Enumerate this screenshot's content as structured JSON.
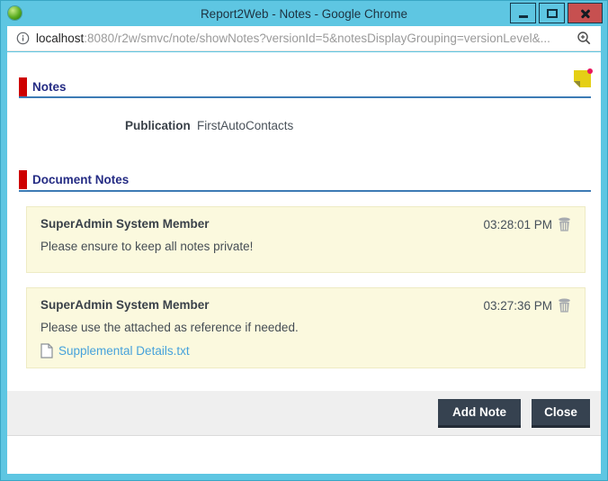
{
  "window": {
    "title": "Report2Web - Notes - Google Chrome"
  },
  "address_bar": {
    "url_host": "localhost",
    "url_path": ":8080/r2w/smvc/note/showNotes?versionId=5&notesDisplayGrouping=versionLevel&..."
  },
  "page": {
    "section_notes": {
      "title": "Notes"
    },
    "publication": {
      "label": "Publication",
      "value": "FirstAutoContacts"
    },
    "section_document_notes": {
      "title": "Document Notes"
    },
    "notes": [
      {
        "author": "SuperAdmin System Member",
        "time": "03:28:01 PM",
        "body": "Please ensure to keep all notes private!"
      },
      {
        "author": "SuperAdmin System Member",
        "time": "03:27:36 PM",
        "body": "Please use the attached as reference if needed.",
        "attachment": "Supplemental Details.txt"
      }
    ],
    "footer": {
      "add_note_label": "Add Note",
      "close_label": "Close"
    }
  },
  "colors": {
    "titlebar": "#5EC6E2",
    "close_button": "#C75050",
    "section_accent": "#CE0000",
    "section_title": "#252C84",
    "section_rule": "#3D7BB5",
    "note_card_bg": "#FBF9DE",
    "link": "#46A2DB",
    "button_bg": "#364250",
    "footer_bg": "#EFEFEF"
  }
}
